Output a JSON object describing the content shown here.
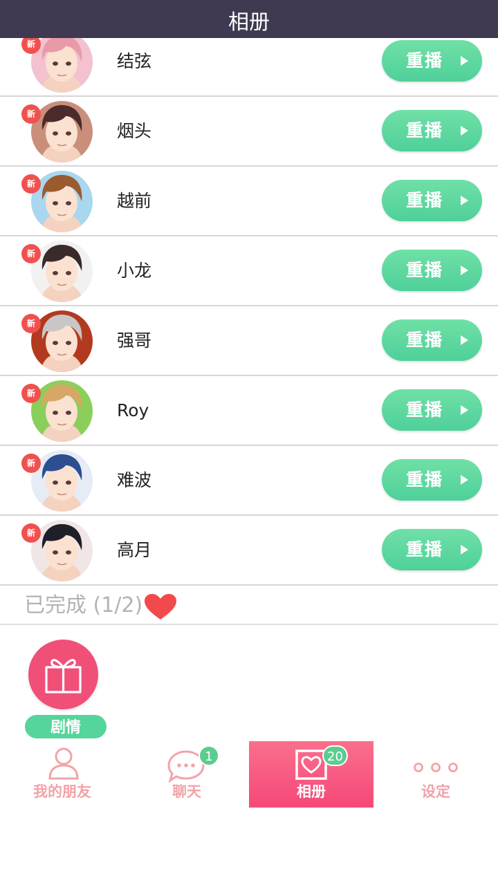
{
  "header": {
    "title": "相册"
  },
  "new_badge": "新",
  "replay_label": "重播",
  "rows": [
    {
      "name": "结弦",
      "hair": "#e99aa8",
      "bg": "#f3c1cf"
    },
    {
      "name": "烟头",
      "hair": "#4b2b2b",
      "bg": "#c98f7a"
    },
    {
      "name": "越前",
      "hair": "#9a5b2f",
      "bg": "#a9d7ef"
    },
    {
      "name": "小龙",
      "hair": "#3a2a2a",
      "bg": "#f1f1f1"
    },
    {
      "name": "强哥",
      "hair": "#c9c6c8",
      "bg": "#b23a1e"
    },
    {
      "name": "Roy",
      "hair": "#d8a766",
      "bg": "#8bcf5b"
    },
    {
      "name": "难波",
      "hair": "#2d4f90",
      "bg": "#e6ecf6"
    },
    {
      "name": "高月",
      "hair": "#1f1f2a",
      "bg": "#f0e6e6"
    }
  ],
  "completed": {
    "label": "已完成 (1/2)"
  },
  "story_button": {
    "label": "剧情"
  },
  "tabs": [
    {
      "label": "我的朋友",
      "icon": "person-icon"
    },
    {
      "label": "聊天",
      "icon": "chat-bubble-icon",
      "count": "1"
    },
    {
      "label": "相册",
      "icon": "photo-heart-icon",
      "count": "20",
      "active": true
    },
    {
      "label": "设定",
      "icon": "more-dots-icon"
    }
  ],
  "colors": {
    "header_bg": "#3f3a52",
    "replay_green": "#5dd9a0",
    "new_badge_red": "#f0504e",
    "active_tab_pink": "#f65680",
    "inactive_tab": "#f2a3a8",
    "heart_red": "#f24a4a"
  }
}
